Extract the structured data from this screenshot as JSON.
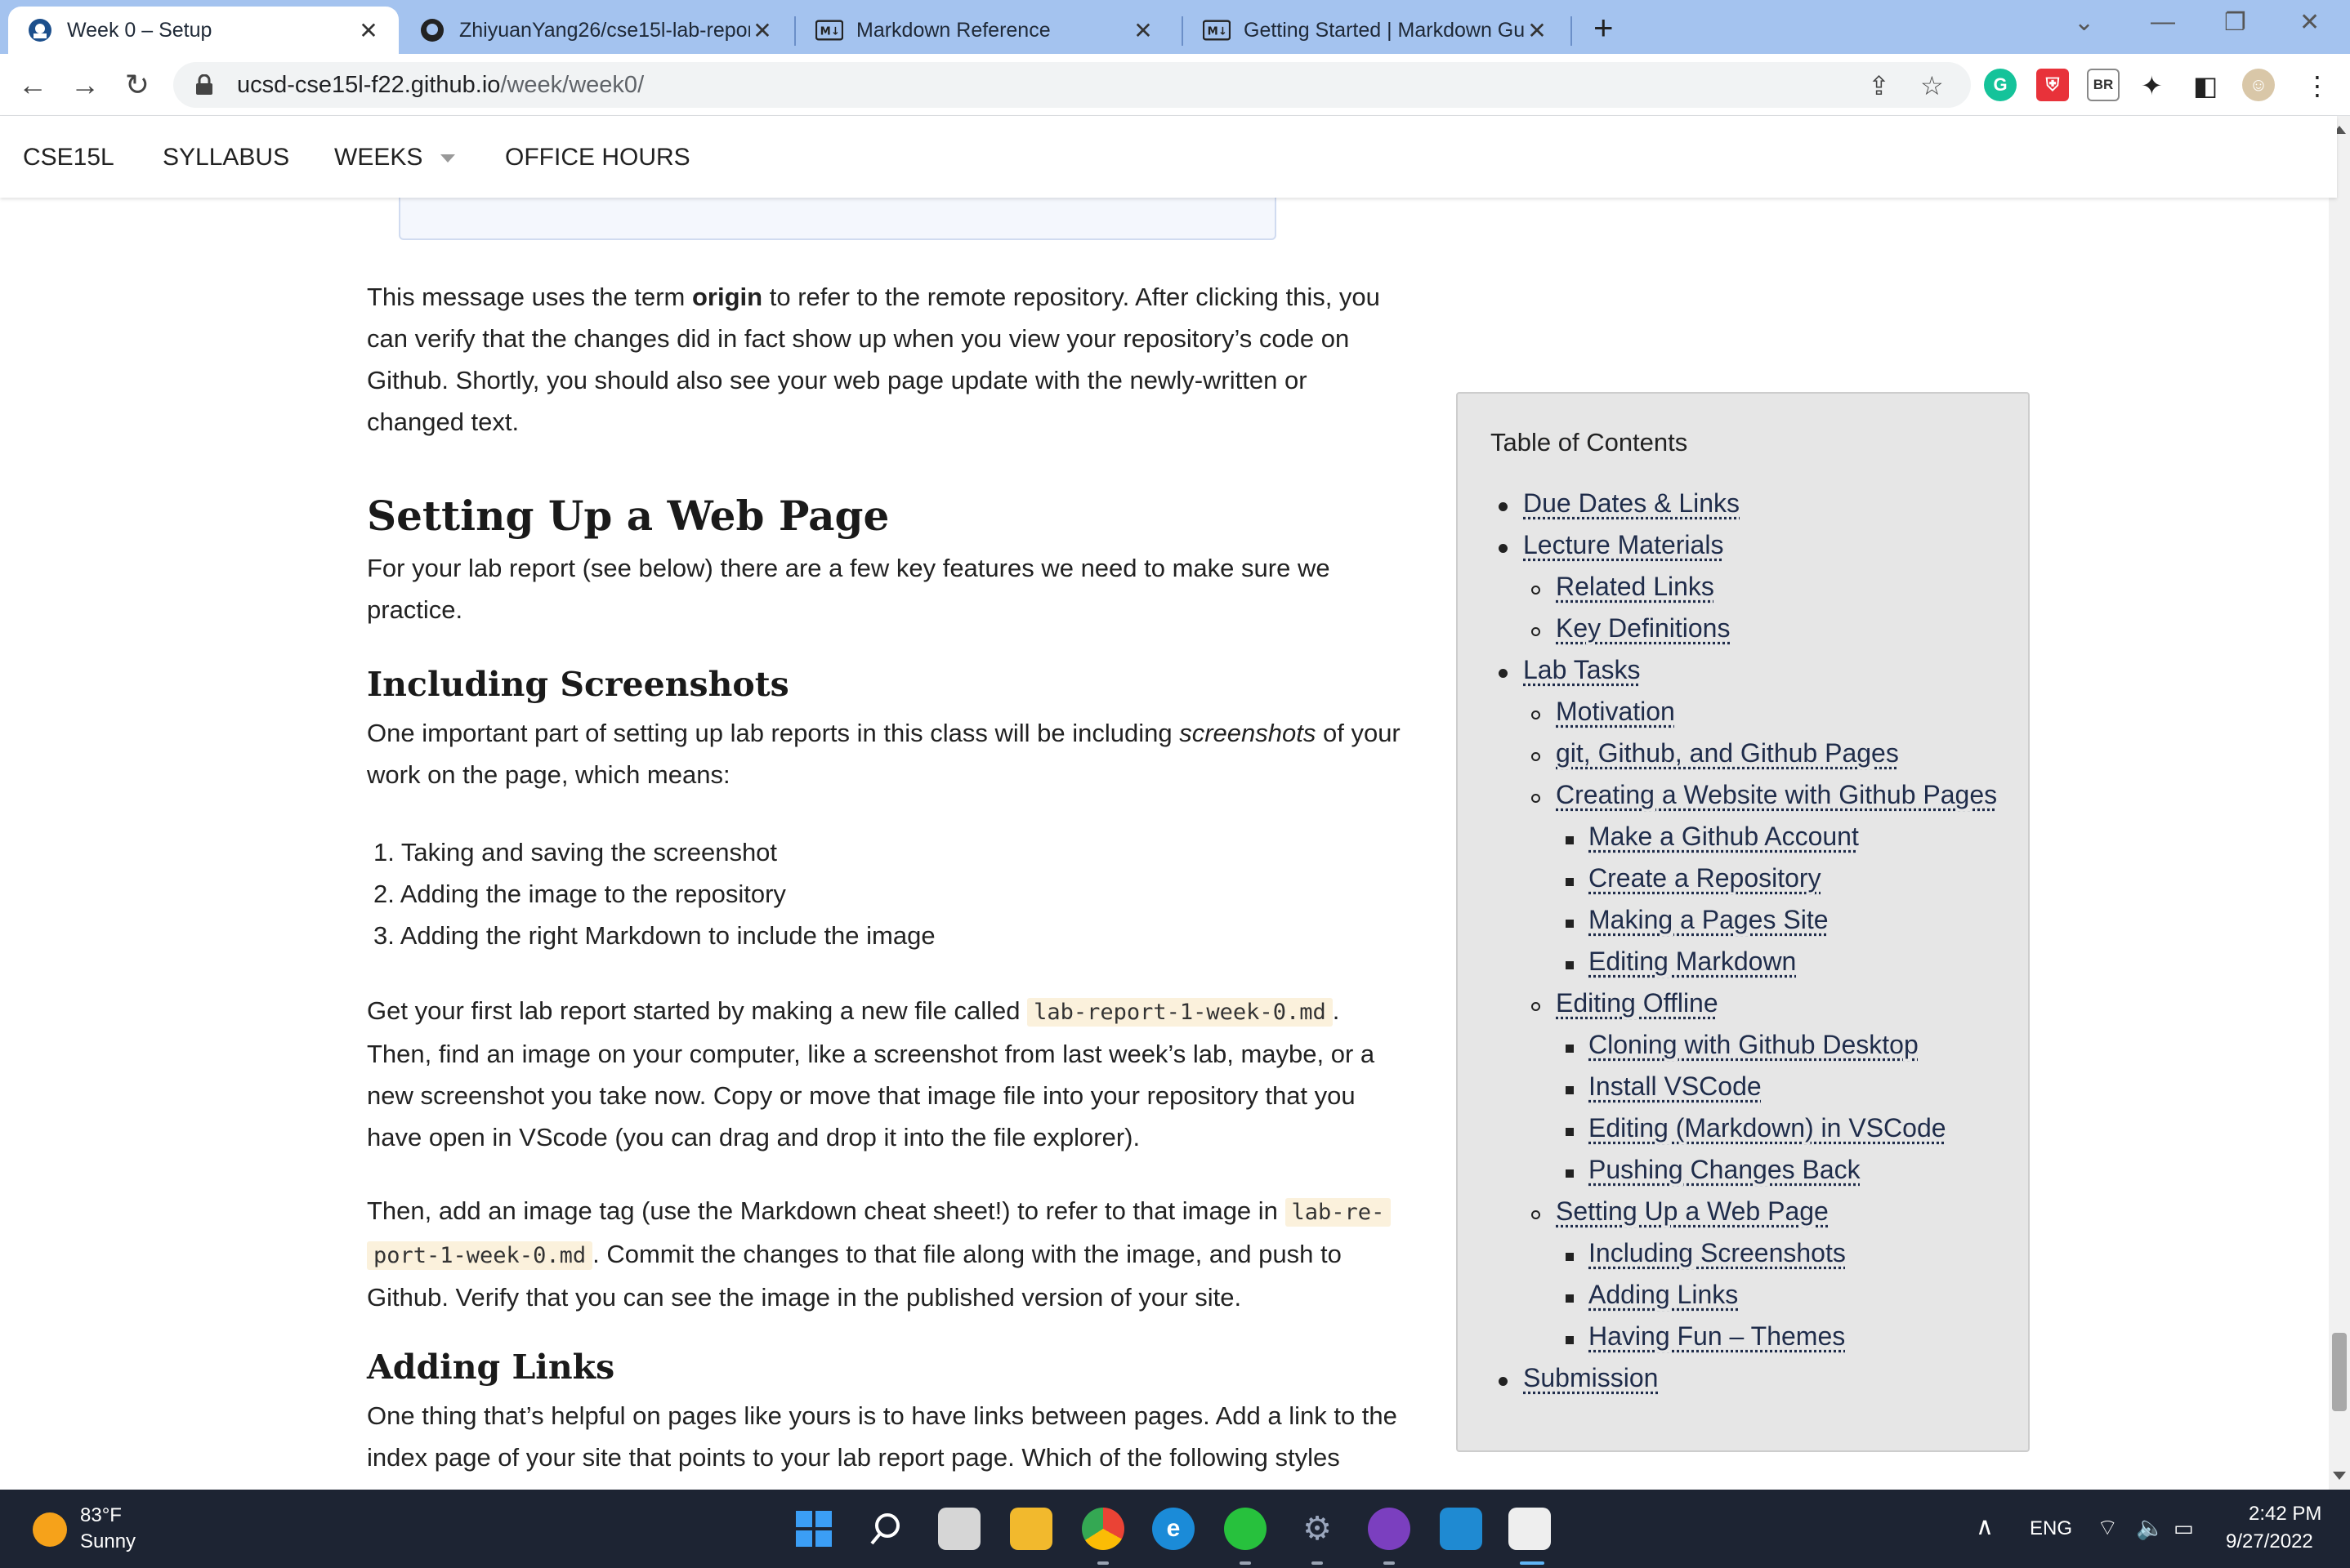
{
  "browser": {
    "tabs": [
      {
        "title": "Week 0 – Setup",
        "favicon": "ucsd-favicon",
        "active": true
      },
      {
        "title": "ZhiyuanYang26/cse15l-lab-repor",
        "favicon": "github-favicon",
        "active": false
      },
      {
        "title": "Markdown Reference",
        "favicon": "markdown-favicon",
        "active": false
      },
      {
        "title": "Getting Started | Markdown Guid",
        "favicon": "markdown-favicon",
        "active": false
      }
    ],
    "url_host": "ucsd-cse15l-f22.github.io",
    "url_path": "/week/week0/",
    "profile_badge": "BR"
  },
  "site_nav": {
    "brand": "CSE15L",
    "syllabus": "SYLLABUS",
    "weeks": "WEEKS",
    "office_hours": "OFFICE HOURS"
  },
  "content": {
    "para_origin": {
      "before": "This message uses the term ",
      "bold": "origin",
      "after": " to refer to the remote repository. After clicking this, you can verify that the changes did in fact show up when you view your repository’s code on Github. Shortly, you should also see your web page update with the newly-written or changed text."
    },
    "h2_setup": "Setting Up a Web Page",
    "para_setup": "For your lab report (see below) there are a few key features we need to make sure we practice.",
    "h3_screenshots": "Including Screenshots",
    "para_screens": {
      "before": "One important part of setting up lab reports in this class will be including ",
      "italic": "screenshots",
      "after": " of your work on the page, which means:"
    },
    "steps": [
      "1. Taking and saving the screenshot",
      "2. Adding the image to the repository",
      "3. Adding the right Markdown to include the image"
    ],
    "para_file": {
      "before": "Get your first lab report started by making a new file called ",
      "code": "lab-report-1-week-0.md",
      "after": ". Then, find an image on your computer, like a screenshot from last week’s lab, maybe, or a new screenshot you take now. Copy or move that image file into your repository that you have open in VScode (you can drag and drop it into the file explorer)."
    },
    "para_tag": {
      "before": "Then, add an image tag (use the Markdown cheat sheet!) to refer to that image in ",
      "code1": "lab-re-",
      "code2": "port-1-week-0.md",
      "after": ". Commit the changes to that file along with the image, and push to Github. Verify that you can see the image in the published version of your site."
    },
    "h3_links": "Adding Links",
    "para_links": "One thing that’s helpful on pages like yours is to have links between pages. Add a link to the index page of your site that points to your lab report page. Which of the following styles"
  },
  "toc": {
    "title": "Table of Contents",
    "items": [
      {
        "label": "Due Dates & Links",
        "level": 1
      },
      {
        "label": "Lecture Materials",
        "level": 1
      },
      {
        "label": "Related Links",
        "level": 2
      },
      {
        "label": "Key Definitions",
        "level": 2
      },
      {
        "label": "Lab Tasks",
        "level": 1
      },
      {
        "label": "Motivation",
        "level": 2
      },
      {
        "label": "git, Github, and Github Pages",
        "level": 2
      },
      {
        "label": "Creating a Website with Github Pages",
        "level": 2
      },
      {
        "label": "Make a Github Account",
        "level": 3
      },
      {
        "label": "Create a Repository",
        "level": 3
      },
      {
        "label": "Making a Pages Site",
        "level": 3
      },
      {
        "label": "Editing Markdown",
        "level": 3
      },
      {
        "label": "Editing Offline",
        "level": 2
      },
      {
        "label": "Cloning with Github Desktop",
        "level": 3
      },
      {
        "label": "Install VSCode",
        "level": 3
      },
      {
        "label": "Editing (Markdown) in VSCode",
        "level": 3
      },
      {
        "label": "Pushing Changes Back",
        "level": 3
      },
      {
        "label": "Setting Up a Web Page",
        "level": 2
      },
      {
        "label": "Including Screenshots",
        "level": 3
      },
      {
        "label": "Adding Links",
        "level": 3
      },
      {
        "label": "Having Fun – Themes",
        "level": 3
      },
      {
        "label": "Submission",
        "level": 1
      }
    ]
  },
  "taskbar": {
    "weather_temp": "83°F",
    "weather_desc": "Sunny",
    "language": "ENG",
    "time": "2:42 PM",
    "date": "9/27/2022"
  }
}
